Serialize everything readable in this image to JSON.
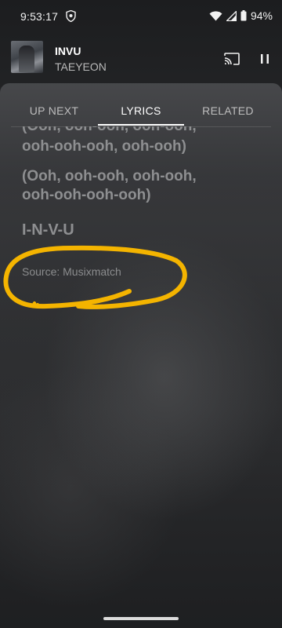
{
  "status_bar": {
    "time": "9:53:17",
    "battery": "94%"
  },
  "now_playing": {
    "title": "INVU",
    "artist": "TAEYEON"
  },
  "tabs": [
    {
      "label": "UP NEXT",
      "selected": false
    },
    {
      "label": "LYRICS",
      "selected": true
    },
    {
      "label": "RELATED",
      "selected": false
    }
  ],
  "lyrics": {
    "partial_line": "(Ooh, ooh-ooh, ooh-ooh,",
    "line_1": "ooh-ooh-ooh, ooh-ooh)",
    "line_2": "(Ooh, ooh-ooh, ooh-ooh,",
    "line_3": "ooh-ooh-ooh-ooh)",
    "line_4": "I-N-V-U",
    "source": "Source: Musixmatch"
  },
  "colors": {
    "annotation": "#f4b400",
    "lyric_text": "#8e8f91",
    "background": "#2a2b2d"
  }
}
